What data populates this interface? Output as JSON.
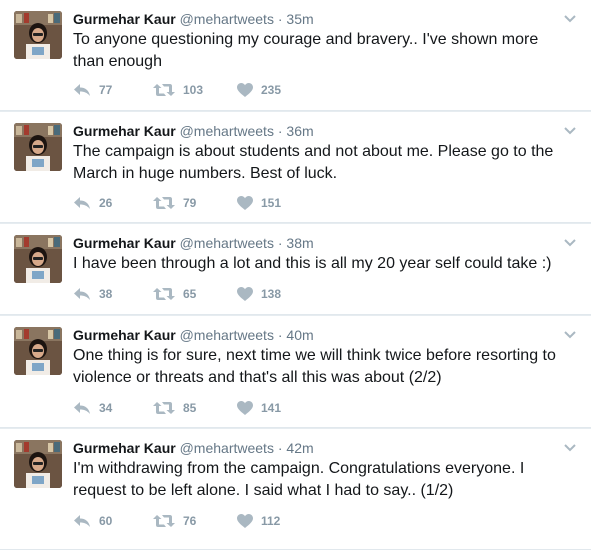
{
  "tweets": [
    {
      "name": "Gurmehar Kaur",
      "handle": "@mehartweets",
      "separator": "·",
      "time": "35m",
      "text": "To anyone questioning my courage and bravery.. I've shown more than enough",
      "replies": "77",
      "retweets": "103",
      "likes": "235"
    },
    {
      "name": "Gurmehar Kaur",
      "handle": "@mehartweets",
      "separator": "·",
      "time": "36m",
      "text": "The campaign is about students and not about me. Please go to the March in huge numbers. Best of luck.",
      "replies": "26",
      "retweets": "79",
      "likes": "151"
    },
    {
      "name": "Gurmehar Kaur",
      "handle": "@mehartweets",
      "separator": "·",
      "time": "38m",
      "text": "I have been through a lot and this is all my 20 year self could take :)",
      "replies": "38",
      "retweets": "65",
      "likes": "138"
    },
    {
      "name": "Gurmehar Kaur",
      "handle": "@mehartweets",
      "separator": "·",
      "time": "40m",
      "text": "One thing is for sure, next time we will think twice before resorting to violence or threats and that's all this was about (2/2)",
      "replies": "34",
      "retweets": "85",
      "likes": "141"
    },
    {
      "name": "Gurmehar Kaur",
      "handle": "@mehartweets",
      "separator": "·",
      "time": "42m",
      "text": "I'm withdrawing from the campaign. Congratulations everyone. I request to be left alone. I said what I had to say.. (1/2)",
      "replies": "60",
      "retweets": "76",
      "likes": "112"
    }
  ],
  "icons": {
    "reply": "reply-icon",
    "retweet": "retweet-icon",
    "like": "heart-icon",
    "menu": "chevron-down-icon"
  },
  "colors": {
    "text": "#14171a",
    "secondary": "#657786",
    "icon": "#aab8c2",
    "divider": "#e1e8ed"
  }
}
